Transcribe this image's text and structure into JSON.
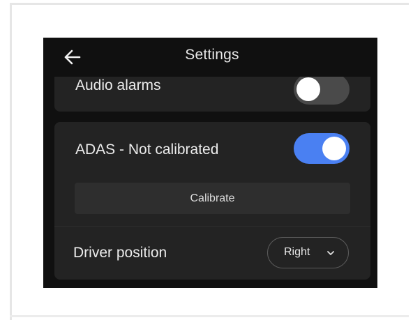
{
  "header": {
    "title": "Settings",
    "back_icon": "arrow-left-icon"
  },
  "settings": {
    "audio_alarms": {
      "label": "Audio alarms",
      "enabled": false
    },
    "adas": {
      "label": "ADAS - Not calibrated",
      "enabled": true,
      "calibrate_label": "Calibrate"
    },
    "driver_position": {
      "label": "Driver position",
      "value": "Right",
      "icon": "chevron-down-icon"
    }
  },
  "colors": {
    "background": "#101010",
    "card": "#232323",
    "toggle_on": "#4a80f2",
    "toggle_off": "#4a4a4a",
    "text": "#ececec"
  }
}
